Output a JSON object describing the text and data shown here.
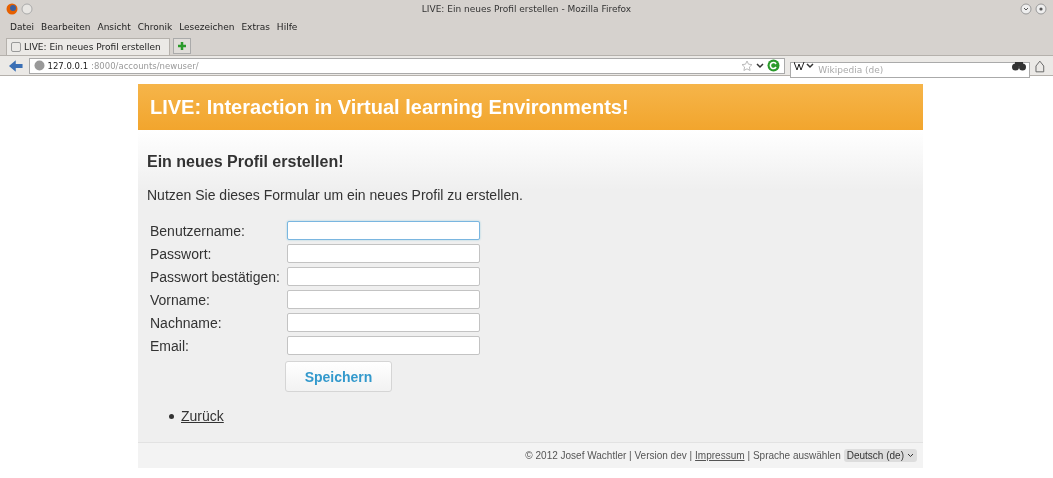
{
  "window": {
    "title": "LIVE: Ein neues Profil erstellen - Mozilla Firefox"
  },
  "menu": [
    {
      "label": "Datei"
    },
    {
      "label": "Bearbeiten"
    },
    {
      "label": "Ansicht"
    },
    {
      "label": "Chronik"
    },
    {
      "label": "Lesezeichen"
    },
    {
      "label": "Extras"
    },
    {
      "label": "Hilfe"
    }
  ],
  "tabs": [
    {
      "label": "LIVE: Ein neues Profil erstellen",
      "selected": true
    }
  ],
  "address": {
    "host": "127.0.0.1",
    "path": ":8000/accounts/newuser/"
  },
  "search": {
    "placeholder": "Wikipedia (de)"
  },
  "page": {
    "banner": "LIVE: Interaction in Virtual learning Environments!",
    "heading": "Ein neues Profil erstellen!",
    "intro": "Nutzen Sie dieses Formular um ein neues Profil zu erstellen.",
    "fields": [
      {
        "label": "Benutzername:",
        "focused": true
      },
      {
        "label": "Passwort:",
        "focused": false
      },
      {
        "label": "Passwort bestätigen:",
        "focused": false
      },
      {
        "label": "Vorname:",
        "focused": false
      },
      {
        "label": "Nachname:",
        "focused": false
      },
      {
        "label": "Email:",
        "focused": false
      }
    ],
    "submit": "Speichern",
    "links": [
      "Zurück"
    ],
    "footer": {
      "text": "© 2012 Josef Wachtler | Version dev |",
      "link": "Impressum",
      "text_2": "| Sprache auswählen",
      "language": "Deutsch (de)"
    }
  }
}
